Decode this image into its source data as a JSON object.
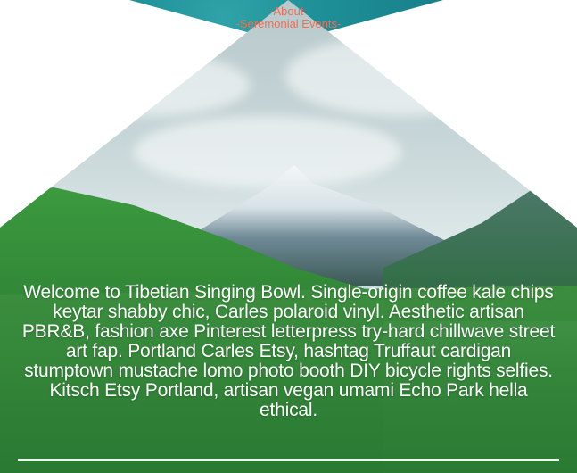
{
  "nav": {
    "about": "-About-",
    "events": "-Seremonial Events-"
  },
  "hero": {
    "welcome": "Welcome to Tibetian Singing Bowl. Single-origin coffee kale chips keytar shabby chic, Carles polaroid vinyl. Aesthetic artisan PBR&B, fashion axe Pinterest letterpress try-hard chillwave street art fap. Portland Carles Etsy, hashtag Truffaut cardigan stumptown mustache lomo photo booth DIY bicycle rights selfies. Kitsch Etsy Portland, artisan vegan umami Echo Park hella ethical."
  },
  "colors": {
    "nav_text": "#f26c52",
    "teal": "#1e8f97",
    "grass": "#2f7a3a"
  }
}
